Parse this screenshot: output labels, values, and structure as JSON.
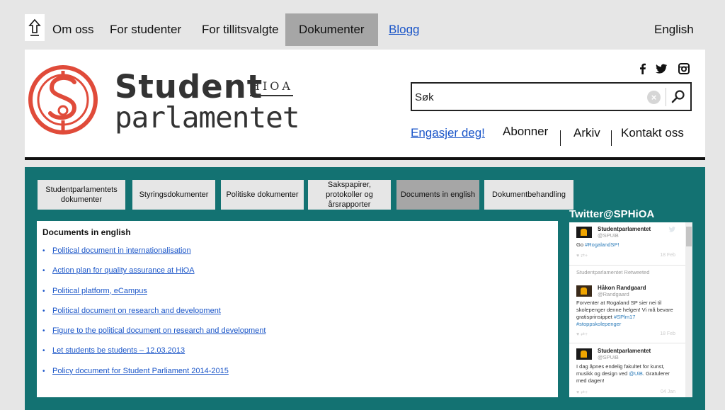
{
  "topnav": {
    "items": [
      {
        "label": "Om oss"
      },
      {
        "label": "For studenter"
      },
      {
        "label": "For tillitsvalgte"
      },
      {
        "label": "Dokumenter",
        "active": true
      },
      {
        "label": "Blogg",
        "link": true
      }
    ],
    "language": "English"
  },
  "header": {
    "logo_line1": "Student",
    "logo_line2": "parlamentet",
    "logo_tag": "HIOA",
    "search_value": "Søk",
    "clear_glyph": "×",
    "links": [
      {
        "label": "Engasjer deg!"
      },
      {
        "label": "Abonner"
      },
      {
        "label": "Arkiv"
      },
      {
        "label": "Kontakt oss"
      }
    ],
    "colors": {
      "logo_red": "#e04b3a",
      "text": "#333333"
    }
  },
  "tabs": [
    {
      "label": "Studentparlamentets dokumenter"
    },
    {
      "label": "Styringsdokumenter"
    },
    {
      "label": "Politiske dokumenter"
    },
    {
      "label": "Sakspapirer, protokoller og årsrapporter"
    },
    {
      "label": "Documents in english",
      "active": true
    },
    {
      "label": "Dokumentbehandling"
    }
  ],
  "documents": {
    "title": "Documents in english",
    "bullet": "•",
    "items": [
      "Political document in internationalisation",
      "Action plan for quality assurance at HiOA",
      "Political platform, eCampus",
      "Political document on research and development",
      "Figure to the political document on research and development",
      "Let students be students – 12.03.2013",
      "Policy document for Student Parliament 2014-2015"
    ]
  },
  "twitter": {
    "title": "Twitter@SPHiOA",
    "tweets": [
      {
        "name": "Studentparlamentet",
        "handle": "@SPUiB",
        "text": "Go ",
        "hashtag": "#RogalandSP!",
        "date": "18 Feb",
        "actions": "♥  ⇄+"
      },
      {
        "retweet_label": "Studentparlamentet Retweeted",
        "name": "Håkon Randgaard",
        "handle": "@Randgaard",
        "text": "Forventer at Rogaland SP sier nei til skolepenger denne helgen! Vi må bevare gratisprinsippet ",
        "hashtag": "#SPlm17 #stoppskolepenger",
        "date": "18 Feb",
        "actions": "♥  ⇄+"
      },
      {
        "name": "Studentparlamentet",
        "handle": "@SPUiB",
        "text": "I dag åpnes endelig fakultet for kunst, musikk og design ved ",
        "hashtag": "@UiB",
        "text2": ". Gratulerer med dagen!",
        "date": "04 Jan",
        "actions": "♥  ⇄+"
      }
    ],
    "colors": {
      "link": "#2b7bb9",
      "teal_bg": "#137272"
    }
  }
}
